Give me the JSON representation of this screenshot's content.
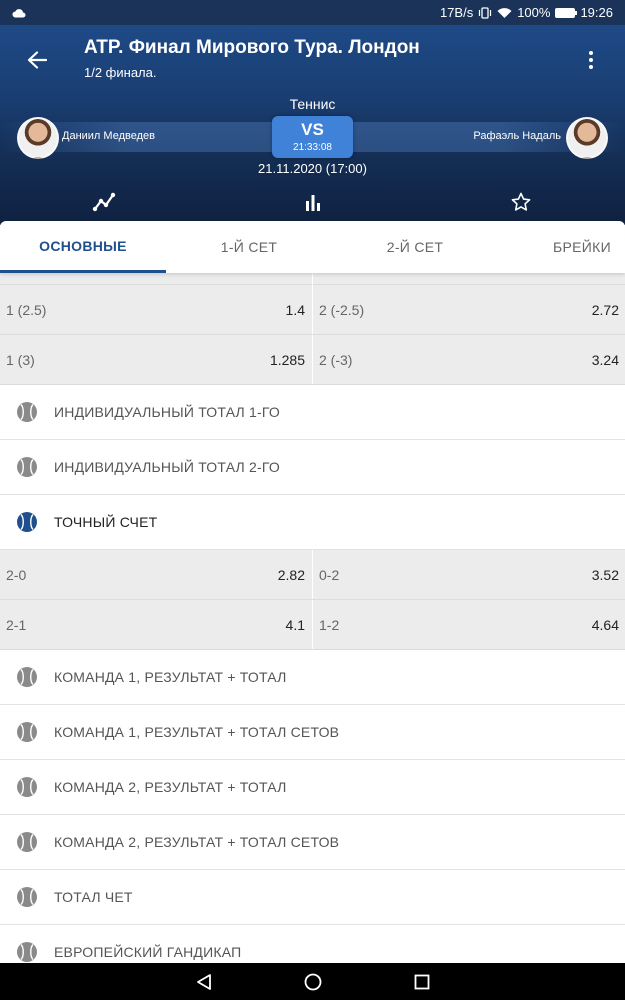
{
  "status": {
    "speed": "17B/s",
    "battery_pct": "100%",
    "time": "19:26",
    "cloud_icon": "cloud-icon",
    "battery_level": 1.0
  },
  "header": {
    "title": "ATP. Финал Мирового Тура. Лондон",
    "subtitle": "1/2 финала.",
    "sport": "Теннис",
    "team1": "Даниил Медведев",
    "team2": "Рафаэль Надаль",
    "vs": "VS",
    "clock": "21:33:08",
    "datetime": "21.11.2020 (17:00)"
  },
  "tabs": [
    {
      "label": "ОСНОВНЫЕ",
      "active": true
    },
    {
      "label": "1-Й СЕТ"
    },
    {
      "label": "2-Й СЕТ"
    },
    {
      "label": "БРЕЙКИ"
    }
  ],
  "handicap_rows": [
    [
      {
        "label": "1 (2.5)",
        "value": "1.4"
      },
      {
        "label": "2 (-2.5)",
        "value": "2.72"
      }
    ],
    [
      {
        "label": "1 (3)",
        "value": "1.285"
      },
      {
        "label": "2 (-3)",
        "value": "3.24"
      }
    ]
  ],
  "markets_a": [
    {
      "label": "ИНДИВИДУАЛЬНЫЙ ТОТАЛ 1-ГО"
    },
    {
      "label": "ИНДИВИДУАЛЬНЫЙ ТОТАЛ 2-ГО"
    },
    {
      "label": "ТОЧНЫЙ СЧЕТ",
      "open": true
    }
  ],
  "score_rows": [
    [
      {
        "label": "2-0",
        "value": "2.82"
      },
      {
        "label": "0-2",
        "value": "3.52"
      }
    ],
    [
      {
        "label": "2-1",
        "value": "4.1"
      },
      {
        "label": "1-2",
        "value": "4.64"
      }
    ]
  ],
  "markets_b": [
    {
      "label": "КОМАНДА 1, РЕЗУЛЬТАТ + ТОТАЛ"
    },
    {
      "label": "КОМАНДА 1, РЕЗУЛЬТАТ + ТОТАЛ СЕТОВ"
    },
    {
      "label": "КОМАНДА 2, РЕЗУЛЬТАТ + ТОТАЛ"
    },
    {
      "label": "КОМАНДА 2, РЕЗУЛЬТАТ + ТОТАЛ СЕТОВ"
    },
    {
      "label": "ТОТАЛ ЧЕТ"
    },
    {
      "label": "ЕВРОПЕЙСКИЙ ГАНДИКАП"
    }
  ],
  "colors": {
    "accent": "#1f4f8c",
    "ball_open": "#1f4f8c",
    "ball_closed": "#8a8a8a",
    "vs_box": "#3f82d8"
  }
}
